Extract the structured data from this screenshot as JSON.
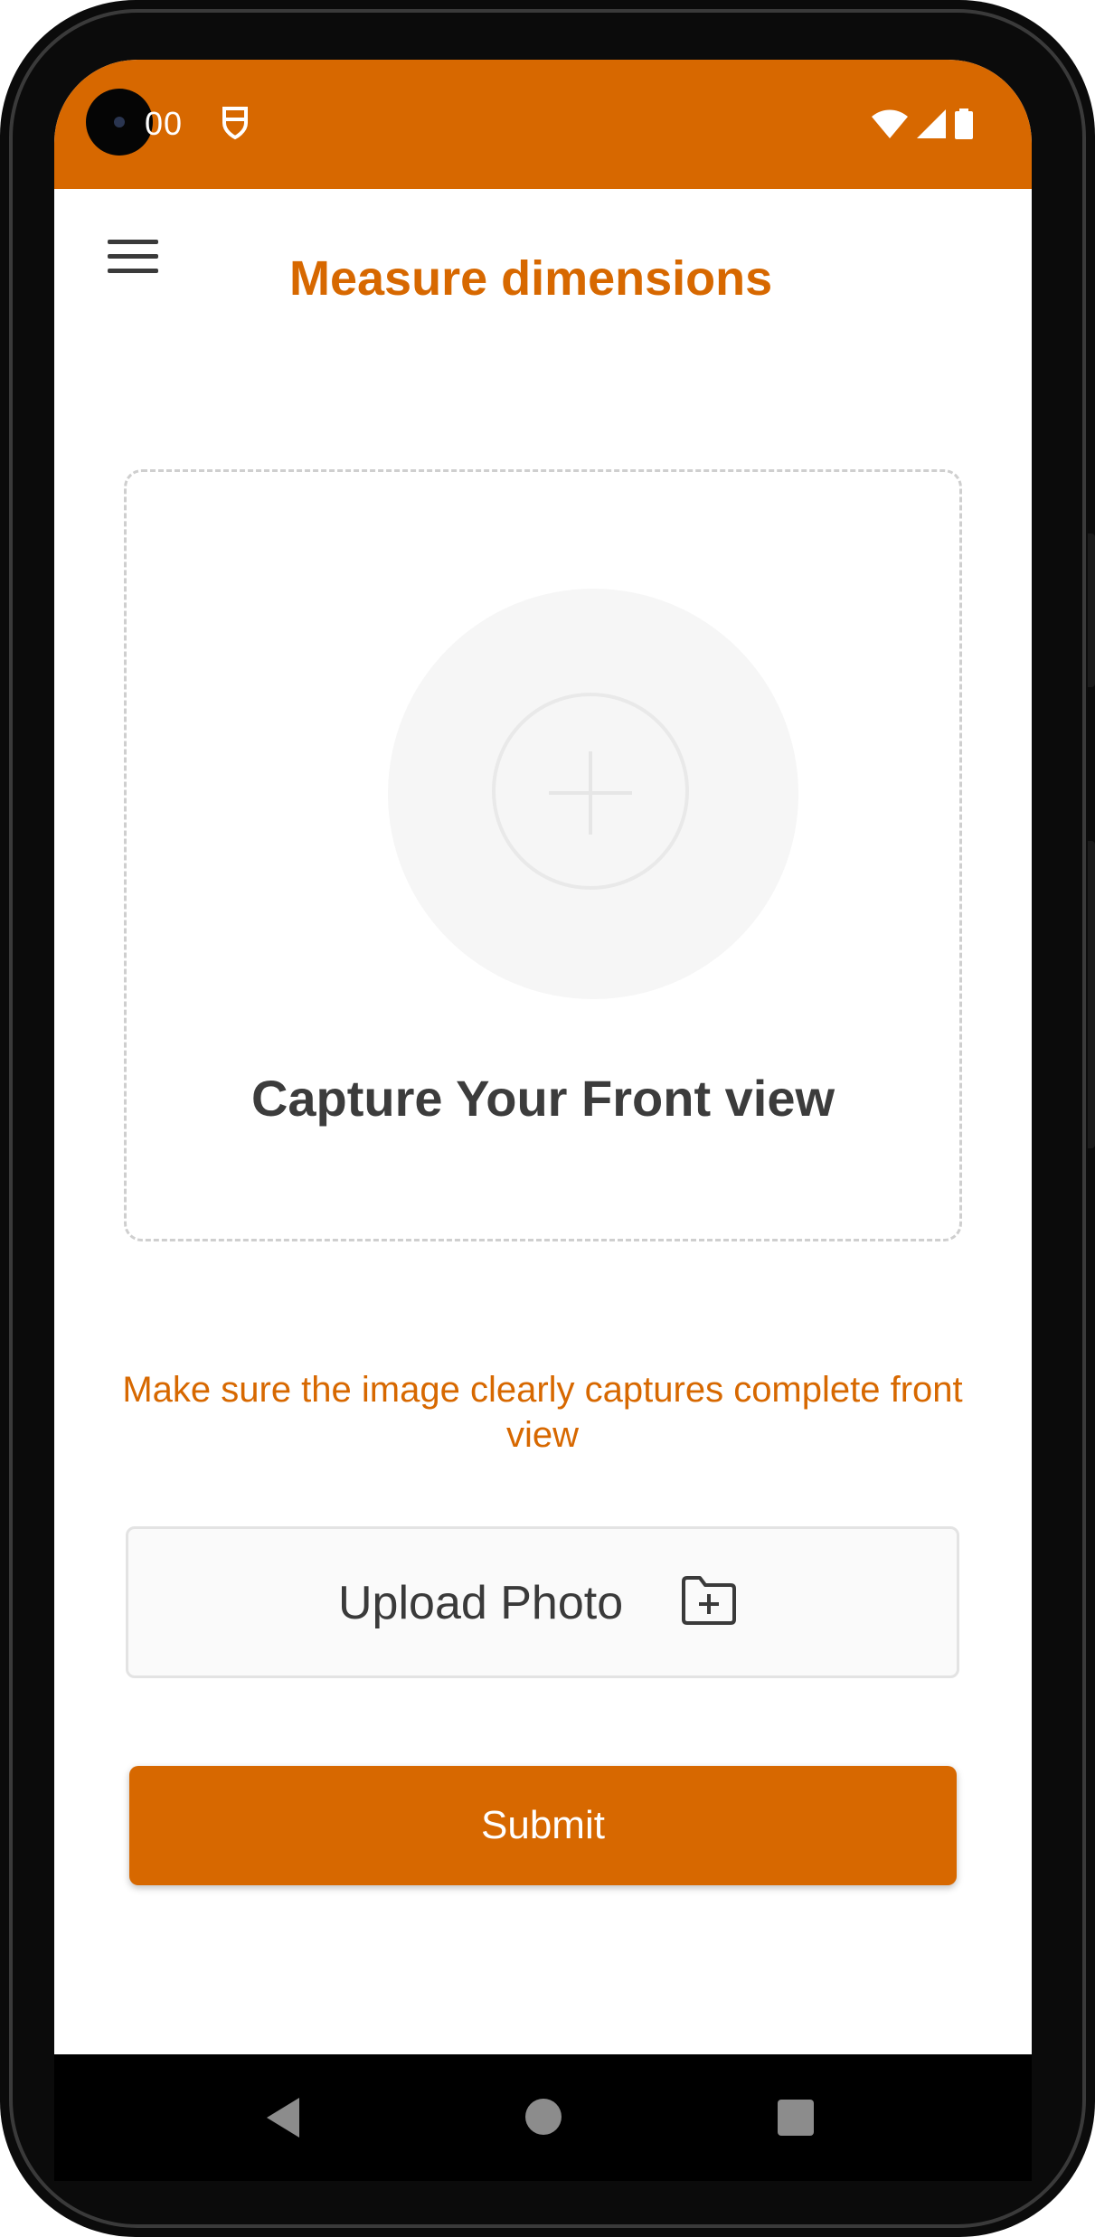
{
  "status_bar": {
    "time": "00",
    "notification_icon": "shield-notification-icon",
    "right_icons": [
      "wifi-icon",
      "cellular-signal-icon",
      "battery-icon"
    ],
    "background_color": "#d76800"
  },
  "header": {
    "title": "Measure dimensions",
    "menu_icon": "hamburger-menu-icon",
    "title_color": "#d76800"
  },
  "capture": {
    "label": "Capture Your Front view",
    "icon": "add-circle-icon"
  },
  "hint": {
    "text": "Make sure the image clearly captures complete front view"
  },
  "upload": {
    "label": "Upload Photo",
    "icon": "folder-add-icon"
  },
  "submit": {
    "label": "Submit",
    "background_color": "#d76800"
  },
  "navigation": {
    "items": [
      "back-icon",
      "home-icon",
      "recents-icon"
    ]
  }
}
